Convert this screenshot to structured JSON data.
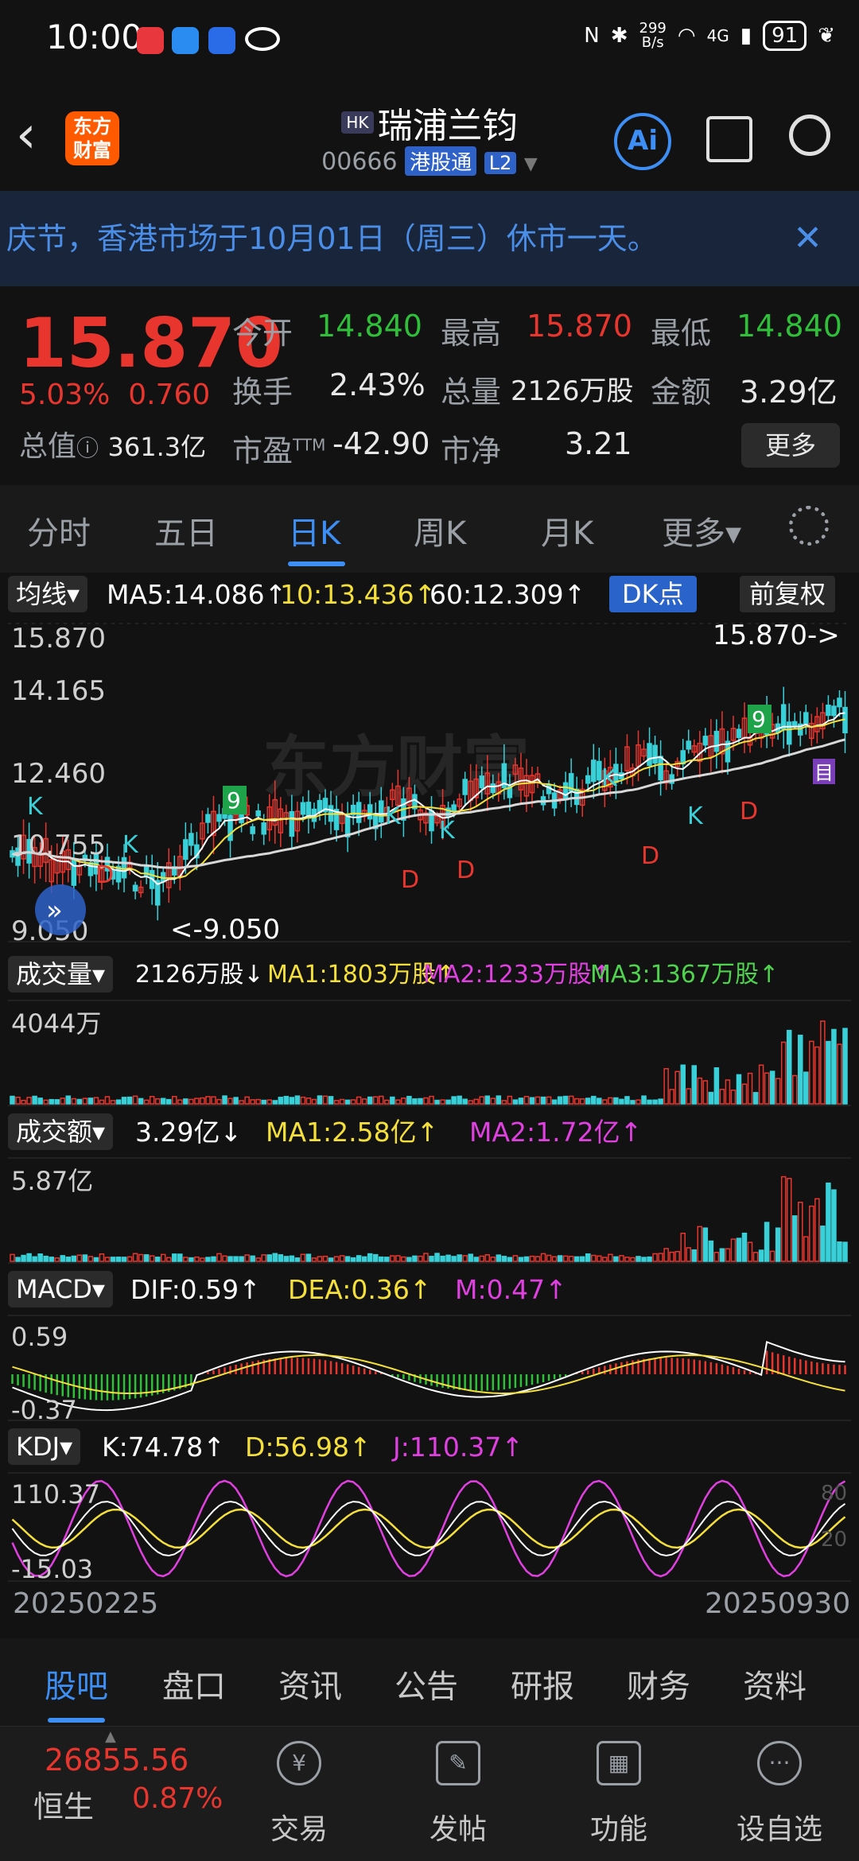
{
  "status_bar": {
    "time": "10:00",
    "net_speed_top": "299",
    "net_speed_bottom": "B/s",
    "signal": "4G",
    "battery": "91"
  },
  "header": {
    "logo_line1": "东方",
    "logo_line2": "财富",
    "market_tag": "HK",
    "stock_name": "瑞浦兰钧",
    "code": "00666",
    "connect_tag": "港股通",
    "level_tag": "L2",
    "ai_label": "Ai"
  },
  "notice": {
    "text": "庆节，香港市场于10月01日（周三）休市一天。",
    "close": "✕"
  },
  "quote": {
    "price": "15.870",
    "change_pct": "5.03%",
    "change_amt": "0.760",
    "market_cap_label": "总值",
    "market_cap": "361.3亿",
    "open_label": "今开",
    "open": "14.840",
    "high_label": "最高",
    "high": "15.870",
    "low_label": "最低",
    "low": "14.840",
    "turnover_label": "换手",
    "turnover": "2.43%",
    "volume_label": "总量",
    "volume": "2126万股",
    "amount_label": "金额",
    "amount": "3.29亿",
    "pe_label": "市盈",
    "pe_sup": "TTM",
    "pe": "-42.90",
    "pb_label": "市净",
    "pb": "3.21",
    "more": "更多"
  },
  "period_tabs": [
    "分时",
    "五日",
    "日K",
    "周K",
    "月K",
    "更多▾"
  ],
  "active_period": "日K",
  "ma_row": {
    "button": "均线▾",
    "ma5": "MA5:14.086↑",
    "ma10": "10:13.436↑",
    "ma60": "60:12.309↑",
    "dk": "DK点",
    "fq": "前复权"
  },
  "kline": {
    "y_top": "15.870",
    "y_2": "14.165",
    "y_3": "12.460",
    "y_4": "10.755",
    "y_bottom": "9.050",
    "high_marker": "15.870->",
    "low_marker": "<-9.050",
    "watermark": "东方财富",
    "signal_k": "K",
    "signal_d": "D",
    "nine_label": "9",
    "mark_pin": "目"
  },
  "volume_row": {
    "button": "成交量▾",
    "current": "2126万股↓",
    "ma1": "MA1:1803万股↑",
    "ma2": "MA2:1233万股↑",
    "ma3": "MA3:1367万股↑",
    "y_max": "4044万"
  },
  "amount_row": {
    "button": "成交额▾",
    "current": "3.29亿↓",
    "ma1": "MA1:2.58亿↑",
    "ma2": "MA2:1.72亿↑",
    "y_max": "5.87亿"
  },
  "macd_row": {
    "button": "MACD▾",
    "dif": "DIF:0.59↑",
    "dea": "DEA:0.36↑",
    "m": "M:0.47↑",
    "y_top": "0.59",
    "y_bottom": "-0.37"
  },
  "kdj_row": {
    "button": "KDJ▾",
    "k": "K:74.78↑",
    "d": "D:56.98↑",
    "j": "J:110.37↑",
    "y_top": "110.37",
    "y_bottom": "-15.03",
    "ref_high": "80",
    "ref_low": "20"
  },
  "dates": {
    "start": "20250225",
    "end": "20250930"
  },
  "bottom_tabs": [
    "股吧",
    "盘口",
    "资讯",
    "公告",
    "研报",
    "财务",
    "资料"
  ],
  "active_bottom_tab": "股吧",
  "bottom_bar": {
    "index_value": "26855.56",
    "index_name": "恒生",
    "index_pct": "0.87%",
    "nav": [
      {
        "label": "交易",
        "icon": "yen-icon",
        "glyph": "¥"
      },
      {
        "label": "发帖",
        "icon": "edit-icon",
        "glyph": "✎"
      },
      {
        "label": "功能",
        "icon": "grid-icon",
        "glyph": "▦"
      },
      {
        "label": "设自选",
        "icon": "more-icon",
        "glyph": "···"
      }
    ]
  },
  "colors": {
    "up": "#e8362f",
    "down": "#2fbf3a",
    "accent": "#3d8ff5",
    "ma5": "#ffffff",
    "ma10": "#f5e03a",
    "ma60": "#e040e0"
  }
}
